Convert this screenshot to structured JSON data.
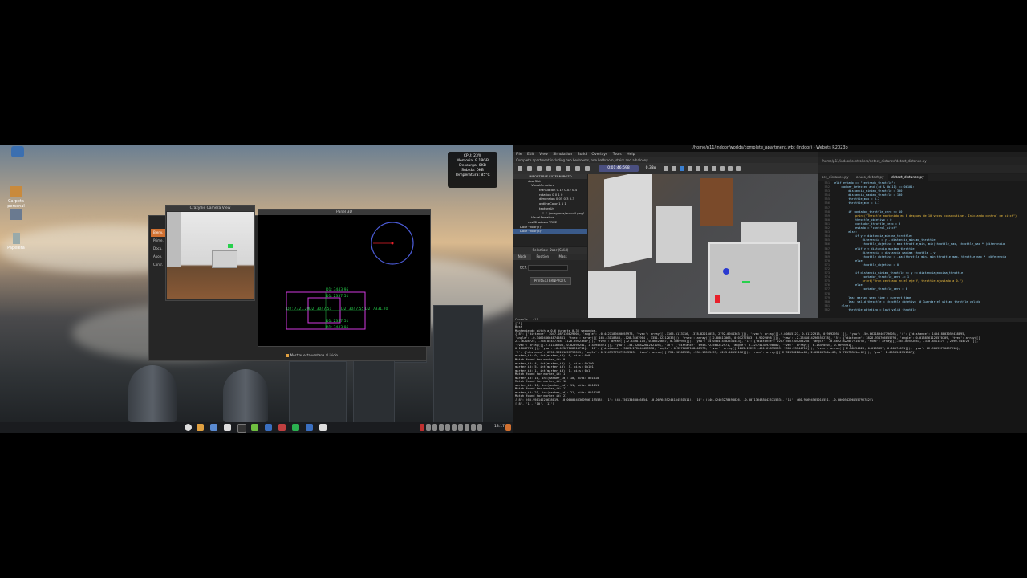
{
  "left": {
    "desktop_icons": [
      {
        "label": "Carpeta personal"
      },
      {
        "label": "Papelera"
      }
    ],
    "system_monitor": {
      "lines": [
        "CPU: 23%",
        "Memoria: 9.18GB",
        "Descarga: 0KB",
        "Subida: 0KB",
        "Temperatura: 85°C"
      ]
    },
    "camera_window": {
      "title": "Crazyflie Camera View"
    },
    "panel_window": {
      "title": "Panel 3D",
      "readouts": [
        "D1: 3443.95",
        "D1: 2337.51",
        "D2: 7321.20",
        "D2: 3047.51",
        "D2: 3047.55",
        "D2: 7331.20",
        "D1: 2337.51",
        "D1: 3443.95"
      ],
      "checkbox_label": "Mostrar esta ventana al inicio"
    },
    "welcome_sidebar": [
      "Bienv.",
      "Prime.",
      "Docu.",
      "Apoy.",
      "Contr."
    ],
    "taskbar": {
      "clock": "18:17"
    }
  },
  "right": {
    "window_title": "/home/p11/indoor/worlds/complete_apartment.wbt (indoor) - Webots R2023b",
    "menu": [
      "File",
      "Edit",
      "View",
      "Simulation",
      "Build",
      "Overlays",
      "Tools",
      "Help"
    ],
    "world_info": "Complete apartment including two bedrooms, one bathroom, stairs and a balcony",
    "sim_time": "0:01:46:698",
    "sim_speed": "0.33x",
    "scene_tree": [
      "IMPORTABLE EXTERNPROTO",
      "doorSlot",
      "VisualArmature",
      "translation 0.12 0.02 0.4",
      "rotation 0 0 1 0",
      "dimension 0.05 0.3 0.3",
      "outlineColor 1 1 1",
      "textureUrl",
      "\"../../imagenes/aruco4.png\"",
      "VisualArmature",
      "castShadows TRUE",
      "Door \"door(7)\"",
      "Door \"door(8)\""
    ],
    "selection_title": "Selection: Door (Solid)",
    "tabs": [
      "Node",
      "Position",
      "Mass"
    ],
    "def_label": "DEF:",
    "print_button": "Print EXTERNPROTO",
    "editor_path": "/home/p11/indoor/controllers/detect_distance/detect_distance.py",
    "editor_tabs": [
      "set_distance.py",
      "aruco_detect.py",
      "detect_distance.py"
    ],
    "code_lines": [
      {
        "n": "551",
        "t": "elif estado == \"centrado_throttle\":"
      },
      {
        "n": "552",
        "t": "    marker_detected and (id & 0b111) == 0b101:"
      },
      {
        "n": "553",
        "t": "        distancia_minima_throttle = 300"
      },
      {
        "n": "554",
        "t": "        distancia_maxima_throttle = 100"
      },
      {
        "n": "555",
        "t": "        throttle_max = 0.2"
      },
      {
        "n": "556",
        "t": "        throttle_min = 0.1"
      },
      {
        "n": "557",
        "t": ""
      },
      {
        "n": "558",
        "t": "        if contador_throttle_cero >= 10:"
      },
      {
        "n": "559",
        "t": "            print(\"Throttle mantenido en 0 despues de 10 veces consecutivas. Iniciando control de pitch\")"
      },
      {
        "n": "560",
        "t": "            throttle_objetivo = 0"
      },
      {
        "n": "561",
        "t": "            contador_throttle_cero = 0"
      },
      {
        "n": "562",
        "t": "            estado = \"control_pitch\""
      },
      {
        "n": "563",
        "t": "        else:"
      },
      {
        "n": "564",
        "t": "            if y > distancia_minima_throttle:"
      },
      {
        "n": "565",
        "t": "                diferencia = y - distancia_minima_throttle"
      },
      {
        "n": "566",
        "t": "                throttle_objetivo = max(throttle_min, min(throttle_max, throttle_max * (diferencia"
      },
      {
        "n": "567",
        "t": "            elif y < distancia_maxima_throttle:"
      },
      {
        "n": "568",
        "t": "                diferencia = distancia_maxima_throttle - y"
      },
      {
        "n": "569",
        "t": "                throttle_objetivo = -max(throttle_min, min(throttle_max, throttle_max * (diferencia"
      },
      {
        "n": "570",
        "t": "            else:"
      },
      {
        "n": "571",
        "t": "                throttle_objetivo = 0"
      },
      {
        "n": "572",
        "t": ""
      },
      {
        "n": "573",
        "t": "            if distancia_minima_throttle >= y >= distancia_maxima_throttle:"
      },
      {
        "n": "574",
        "t": "                contador_throttle_cero += 1"
      },
      {
        "n": "575",
        "t": "                print(\"Dron centrado en el eje Y, throttle ajustado a 0.\")"
      },
      {
        "n": "576",
        "t": "            else:"
      },
      {
        "n": "577",
        "t": "                contador_throttle_cero = 0"
      },
      {
        "n": "578",
        "t": ""
      },
      {
        "n": "579",
        "t": "        last_marker_seen_time = current_time"
      },
      {
        "n": "580",
        "t": "        last_valid_throttle = throttle_objetivo  # Guardar el ultimo throttle valido"
      },
      {
        "n": "581",
        "t": "    else:"
      },
      {
        "n": "582",
        "t": "        throttle_objetivo = last_valid_throttle"
      }
    ],
    "console_title": "Console - All",
    "console_lines": [
      "[21]",
      "Bost",
      "Manteniendo pitch a 0.6 durante 0.36 segundos.",
      "{'8': {'distance': 3047.087136629906, 'angle': -0.4427189490055978, 'tvec': array([[-1165.5113716,  -378.82215053,  2792.0944363 ]]), 'rvec': array([[-2.80815127,  0.01122913,  0.9092951 ]]), 'yaw': -50.06218946779605}, '4': {'distance': 1404.8803052438895,",
      "'angle': -0.3460486648745881, 'tvec': array([[ 165.43118848,  -128.3167904 ,  1351.82212636]]), 'rvec': array([[-2.80817063,  0.01277853,  0.9022098 ]]), 'yaw': -2.2341014296556278}, '5': {'distance': 3828.934766055798, 'angle': 0.0138561123570709, 'tvec': array([[",
      "23.36228725,  -768.85447758,  3120.89623807]]), 'rvec': array([[-2.83981115,  0.06525667,  0.3069955]]), 'yaw': 14.048474402534443}, '1': {'distance': 2287.5067305284268, 'angle': -0.38227822077215756, 'tvec': array([[-464.89522041,  -330.8511475 , 2090.544723 ]]),",
      "'rvec': array([[-2.81116808,  0.02599241,  1.44953521]]), 'yaw': -54.52882261202105}, '10': {'distance': 6948.722568242971, 'angle': 0.324741469298082, 'tvec': array([[ 0.18470504,  0.9699491],",
      "0.11007741]]), 'yaw': -6.02367168614711}, '11': {'distance': 3063.272644427838, 'angle': 0.3270687158401976, 'tvec': array([[1203.22239  -451.61893269, 1905.23744715]]), 'rvec': array([[ 2.88194023,  0.0153827,  0.00574691]]), 'yaw': 82.90393730097618},",
      "'2': {'distance': 6598.39231657796591, 'angle': 0.11499779079343913, 'tvec': array([[ 721.20968956,  -534.13565499, 6245.46155116]]), 'rvec': array([[ 2.92598226e+00,  2.02260780e-03,  5.78178311e-02]]), 'yaw': 2.0653542151807}}",
      "marker_id: 0, int(marker_id): 0, bits: 0b0",
      "Match found for marker_id: 0",
      "marker_id: 4, int(marker_id): 4, bits: 0b100",
      "marker_id: 5, int(marker_id): 5, bits: 0b101",
      "marker_id: 1, int(marker_id): 1, bits: 0b1",
      "Match found for marker_id: 1",
      "marker_id: 10, int(marker_id): 10, bits: 0b1010",
      "Match found for marker_id: 10",
      "marker_id: 11, int(marker_id): 11, bits: 0b1011",
      "Match found for marker_id: 11",
      "marker_id: 21, int(marker_id): 21, bits: 0b10101",
      "Match found for marker_id: 21",
      "{'8': (60.95014223638019, -0.0000543360906119558), '1': (45.75013463046854, -0.0076455244154551511), '10': (146.42403278498826, -0.007136485442571563), '11': (60.91694565015551, -0.000054296455796782)}",
      "['8', '1', '10', '11']"
    ]
  },
  "colors": {
    "accent": "#4b5bd6",
    "magenta": "#d23adf",
    "green": "#27d04c",
    "red": "#e8202a"
  }
}
